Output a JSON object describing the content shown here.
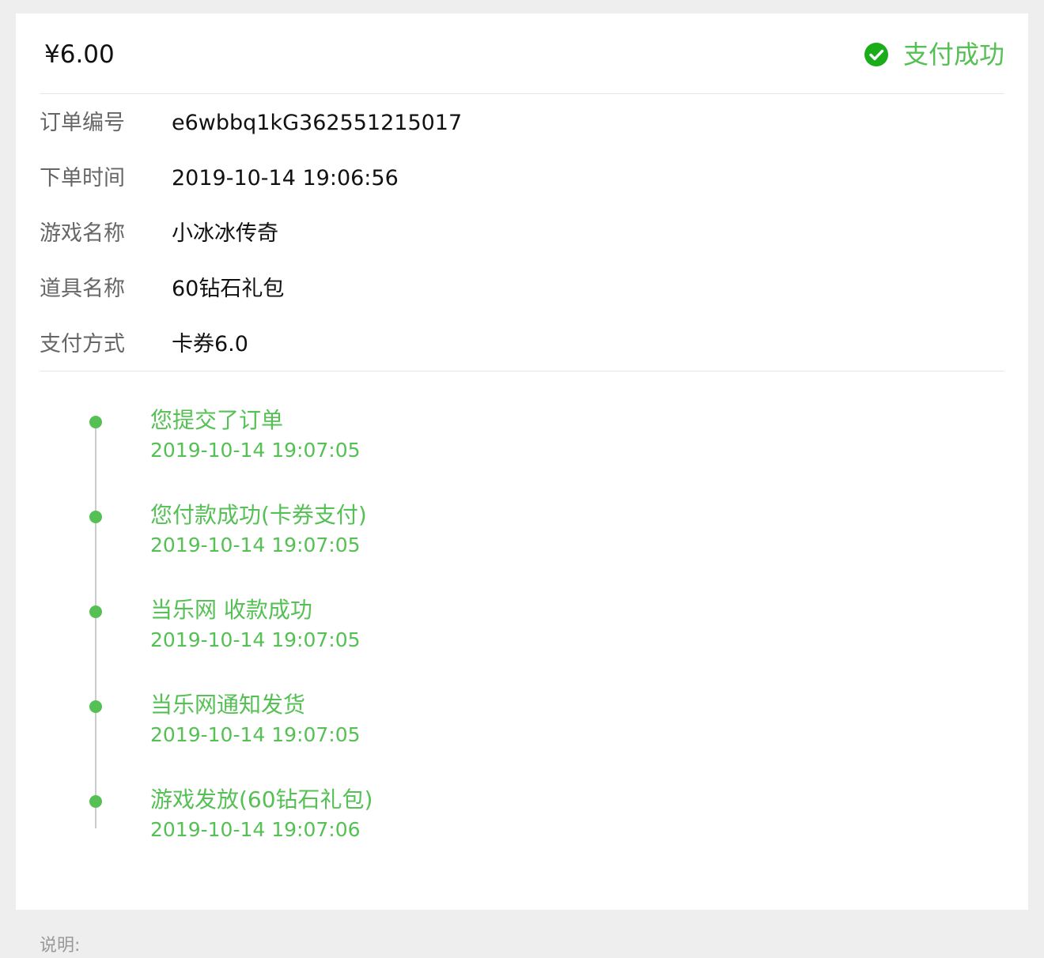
{
  "order": {
    "amount": "¥6.00",
    "status_text": "支付成功",
    "status_icon": "check-circle-icon",
    "status_color": "#55c054"
  },
  "details": [
    {
      "label": "订单编号",
      "value": "e6wbbq1kG362551215017"
    },
    {
      "label": "下单时间",
      "value": "2019-10-14 19:06:56"
    },
    {
      "label": "游戏名称",
      "value": "小冰冰传奇"
    },
    {
      "label": "道具名称",
      "value": "60钻石礼包"
    },
    {
      "label": "支付方式",
      "value": "卡券6.0"
    }
  ],
  "timeline": [
    {
      "title": "您提交了订单",
      "time": "2019-10-14 19:07:05"
    },
    {
      "title": "您付款成功(卡券支付)",
      "time": "2019-10-14 19:07:05"
    },
    {
      "title": "当乐网 收款成功",
      "time": "2019-10-14 19:07:05"
    },
    {
      "title": "当乐网通知发货",
      "time": "2019-10-14 19:07:05"
    },
    {
      "title": "游戏发放(60钻石礼包)",
      "time": "2019-10-14 19:07:06"
    }
  ],
  "footer": {
    "note_label": "说明:"
  }
}
